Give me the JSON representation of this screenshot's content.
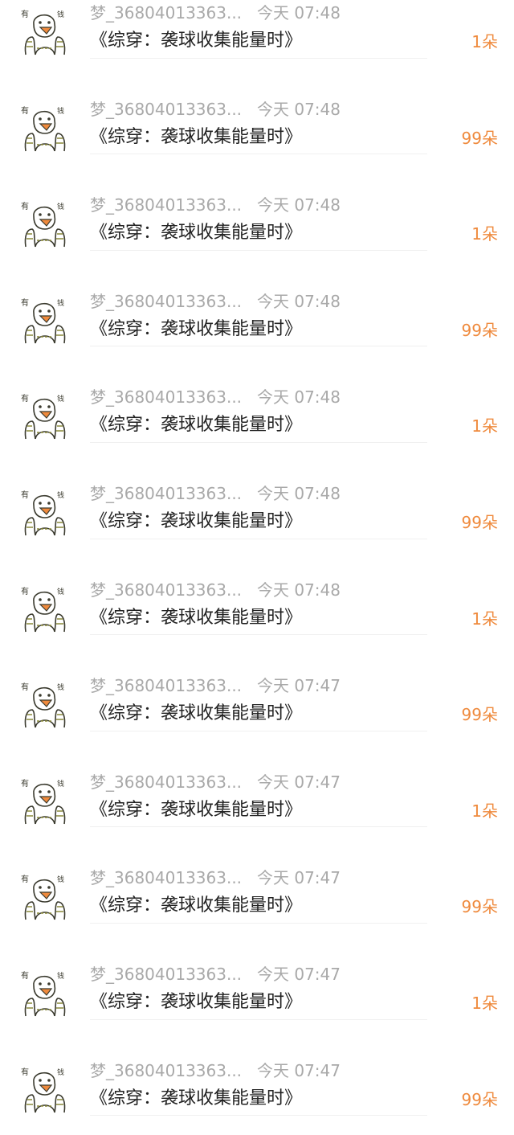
{
  "colors": {
    "accent": "#ef8a3d",
    "meta": "#a9a9a9",
    "title": "#222222",
    "divider": "#f0f0f0"
  },
  "avatar": {
    "icon": "duck-avatar-icon",
    "left_char": "有",
    "right_char": "钱"
  },
  "records": [
    {
      "user": "梦_36804013363...",
      "time": "今天 07:48",
      "title": "《综穿：袭球收集能量时》",
      "gift": "1朵"
    },
    {
      "user": "梦_36804013363...",
      "time": "今天 07:48",
      "title": "《综穿：袭球收集能量时》",
      "gift": "99朵"
    },
    {
      "user": "梦_36804013363...",
      "time": "今天 07:48",
      "title": "《综穿：袭球收集能量时》",
      "gift": "1朵"
    },
    {
      "user": "梦_36804013363...",
      "time": "今天 07:48",
      "title": "《综穿：袭球收集能量时》",
      "gift": "99朵"
    },
    {
      "user": "梦_36804013363...",
      "time": "今天 07:48",
      "title": "《综穿：袭球收集能量时》",
      "gift": "1朵"
    },
    {
      "user": "梦_36804013363...",
      "time": "今天 07:48",
      "title": "《综穿：袭球收集能量时》",
      "gift": "99朵"
    },
    {
      "user": "梦_36804013363...",
      "time": "今天 07:48",
      "title": "《综穿：袭球收集能量时》",
      "gift": "1朵"
    },
    {
      "user": "梦_36804013363...",
      "time": "今天 07:47",
      "title": "《综穿：袭球收集能量时》",
      "gift": "99朵"
    },
    {
      "user": "梦_36804013363...",
      "time": "今天 07:47",
      "title": "《综穿：袭球收集能量时》",
      "gift": "1朵"
    },
    {
      "user": "梦_36804013363...",
      "time": "今天 07:47",
      "title": "《综穿：袭球收集能量时》",
      "gift": "99朵"
    },
    {
      "user": "梦_36804013363...",
      "time": "今天 07:47",
      "title": "《综穿：袭球收集能量时》",
      "gift": "1朵"
    },
    {
      "user": "梦_36804013363...",
      "time": "今天 07:47",
      "title": "《综穿：袭球收集能量时》",
      "gift": "99朵"
    }
  ]
}
